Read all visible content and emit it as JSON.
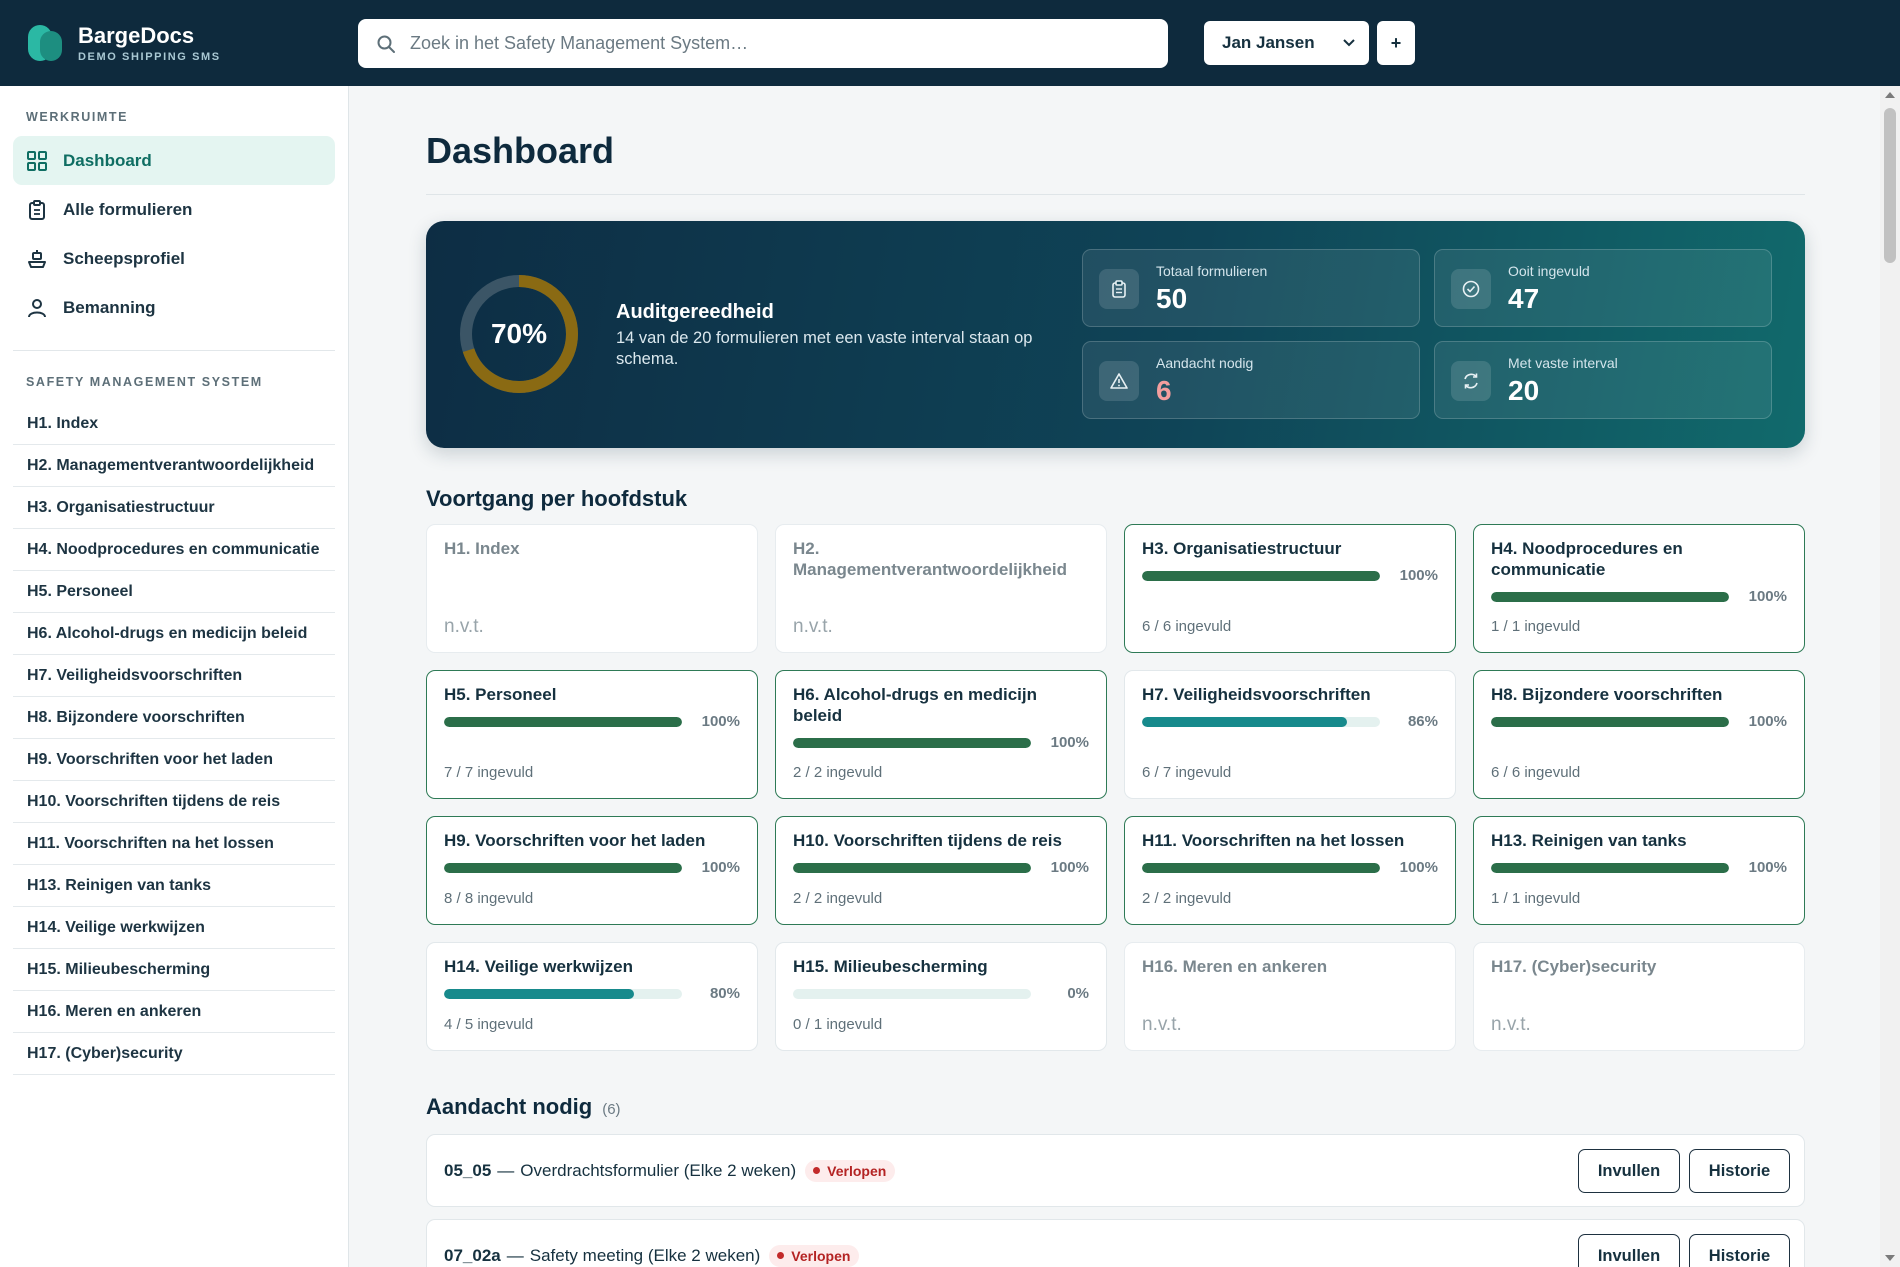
{
  "brand": {
    "name": "BargeDocs",
    "subtitle": "DEMO SHIPPING SMS"
  },
  "search": {
    "placeholder": "Zoek in het Safety Management System…"
  },
  "user": {
    "name": "Jan Jansen",
    "add_label": "+"
  },
  "sidebar": {
    "workspace_heading": "WERKRUIMTE",
    "items": [
      {
        "label": "Dashboard",
        "icon": "grid-icon",
        "active": true
      },
      {
        "label": "Alle formulieren",
        "icon": "clipboard-icon",
        "active": false
      },
      {
        "label": "Scheepsprofiel",
        "icon": "ship-icon",
        "active": false
      },
      {
        "label": "Bemanning",
        "icon": "user-icon",
        "active": false
      }
    ],
    "sms_heading": "SAFETY MANAGEMENT SYSTEM",
    "chapters": [
      "H1. Index",
      "H2. Managementverantwoordelijkheid",
      "H3. Organisatiestructuur",
      "H4. Noodprocedures en communicatie",
      "H5. Personeel",
      "H6. Alcohol-drugs en medicijn beleid",
      "H7. Veiligheidsvoorschriften",
      "H8. Bijzondere voorschriften",
      "H9. Voorschriften voor het laden",
      "H10. Voorschriften tijdens de reis",
      "H11. Voorschriften na het lossen",
      "H13. Reinigen van tanks",
      "H14. Veilige werkwijzen",
      "H15. Milieubescherming",
      "H16. Meren en ankeren",
      "H17. (Cyber)security"
    ]
  },
  "main": {
    "title": "Dashboard",
    "audit": {
      "percent_label": "70%",
      "percent": 70,
      "title": "Auditgereedheid",
      "subtitle": "14 van de 20 formulieren met een vaste interval staan op schema.",
      "ring_color": "#8a6a13",
      "ring_track_color": "#3b5566"
    },
    "stats": [
      {
        "label": "Totaal formulieren",
        "value": "50",
        "icon": "clipboard-icon",
        "warn": false
      },
      {
        "label": "Ooit ingevuld",
        "value": "47",
        "icon": "check-circle-icon",
        "warn": false
      },
      {
        "label": "Aandacht nodig",
        "value": "6",
        "icon": "warning-icon",
        "warn": true
      },
      {
        "label": "Met vaste interval",
        "value": "20",
        "icon": "refresh-icon",
        "warn": false
      }
    ],
    "progress_title": "Voortgang per hoofdstuk",
    "chapters": [
      {
        "title": "H1. Index",
        "na": true,
        "na_label": "n.v.t."
      },
      {
        "title": "H2. Managementverantwoordelijkheid",
        "na": true,
        "na_label": "n.v.t."
      },
      {
        "title": "H3. Organisatiestructuur",
        "percent": 100,
        "percent_label": "100%",
        "count": "6 / 6 ingevuld"
      },
      {
        "title": "H4. Noodprocedures en communicatie",
        "percent": 100,
        "percent_label": "100%",
        "count": "1 / 1 ingevuld"
      },
      {
        "title": "H5. Personeel",
        "percent": 100,
        "percent_label": "100%",
        "count": "7 / 7 ingevuld"
      },
      {
        "title": "H6. Alcohol-drugs en medicijn beleid",
        "percent": 100,
        "percent_label": "100%",
        "count": "2 / 2 ingevuld"
      },
      {
        "title": "H7. Veiligheidsvoorschriften",
        "percent": 86,
        "percent_label": "86%",
        "count": "6 / 7 ingevuld"
      },
      {
        "title": "H8. Bijzondere voorschriften",
        "percent": 100,
        "percent_label": "100%",
        "count": "6 / 6 ingevuld"
      },
      {
        "title": "H9. Voorschriften voor het laden",
        "percent": 100,
        "percent_label": "100%",
        "count": "8 / 8 ingevuld"
      },
      {
        "title": "H10. Voorschriften tijdens de reis",
        "percent": 100,
        "percent_label": "100%",
        "count": "2 / 2 ingevuld"
      },
      {
        "title": "H11. Voorschriften na het lossen",
        "percent": 100,
        "percent_label": "100%",
        "count": "2 / 2 ingevuld"
      },
      {
        "title": "H13. Reinigen van tanks",
        "percent": 100,
        "percent_label": "100%",
        "count": "1 / 1 ingevuld"
      },
      {
        "title": "H14. Veilige werkwijzen",
        "percent": 80,
        "percent_label": "80%",
        "count": "4 / 5 ingevuld"
      },
      {
        "title": "H15. Milieubescherming",
        "percent": 0,
        "percent_label": "0%",
        "count": "0 / 1 ingevuld"
      },
      {
        "title": "H16. Meren en ankeren",
        "na": true,
        "na_label": "n.v.t."
      },
      {
        "title": "H17. (Cyber)security",
        "na": true,
        "na_label": "n.v.t."
      }
    ],
    "colors": {
      "complete": "#2b6e49",
      "partial": "#178a8c"
    },
    "attention": {
      "title": "Aandacht nodig",
      "count_label": "(6)",
      "rows": [
        {
          "code": "05_05",
          "dash": "—",
          "name": "Overdrachtsformulier (Elke 2 weken)",
          "badge": "Verlopen",
          "fill_label": "Invullen",
          "history_label": "Historie"
        },
        {
          "code": "07_02a",
          "dash": "—",
          "name": "Safety meeting (Elke 2 weken)",
          "badge": "Verlopen",
          "fill_label": "Invullen",
          "history_label": "Historie"
        }
      ]
    }
  }
}
